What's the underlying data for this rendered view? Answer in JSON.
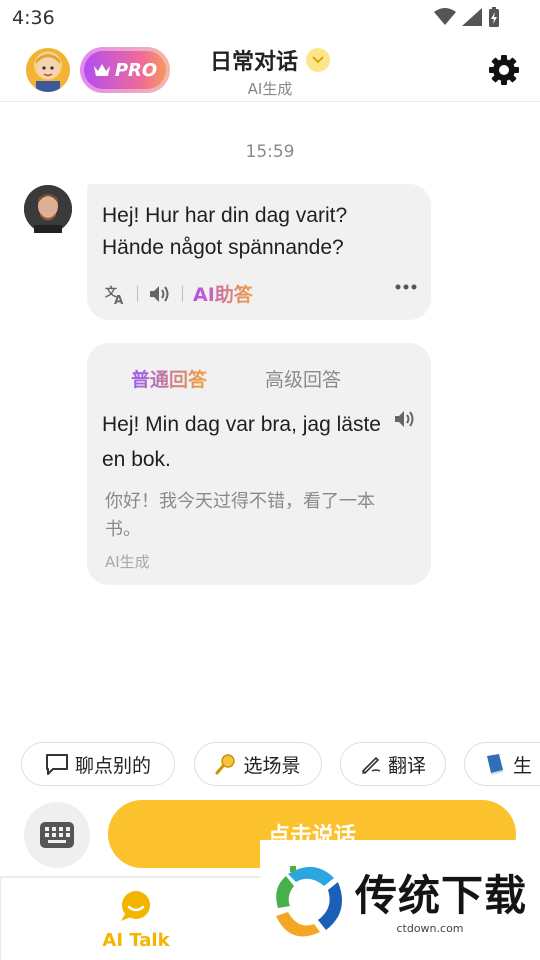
{
  "status_bar": {
    "time": "4:36"
  },
  "header": {
    "pro_label": "PRO",
    "title": "日常对话",
    "subtitle": "AI生成"
  },
  "chat": {
    "timestamp": "15:59",
    "bot_message": "Hej! Hur har din dag varit? Hände något spännande?",
    "ai_help_label": "AI助答",
    "reply": {
      "tabs": [
        "普通回答",
        "高级回答"
      ],
      "text": "Hej! Min dag var bra, jag läste en bok.",
      "translation": "你好！我今天过得不错，看了一本书。",
      "ai_label": "AI生成"
    }
  },
  "chips": [
    {
      "icon": "speech-bubble-icon",
      "label": "聊点别的"
    },
    {
      "icon": "magnifier-icon",
      "label": "选场景"
    },
    {
      "icon": "pen-icon",
      "label": "翻译"
    },
    {
      "icon": "book-icon",
      "label": "生"
    }
  ],
  "input": {
    "talk_label": "点击说话"
  },
  "bottom_nav": {
    "items": [
      {
        "label": "AI Talk",
        "active": true
      }
    ]
  },
  "watermark": {
    "text": "传统下载",
    "url": "ctdown.com"
  },
  "colors": {
    "accent": "#fcc22e",
    "nav_active": "#f5b400",
    "bubble": "#f1f1f1"
  }
}
